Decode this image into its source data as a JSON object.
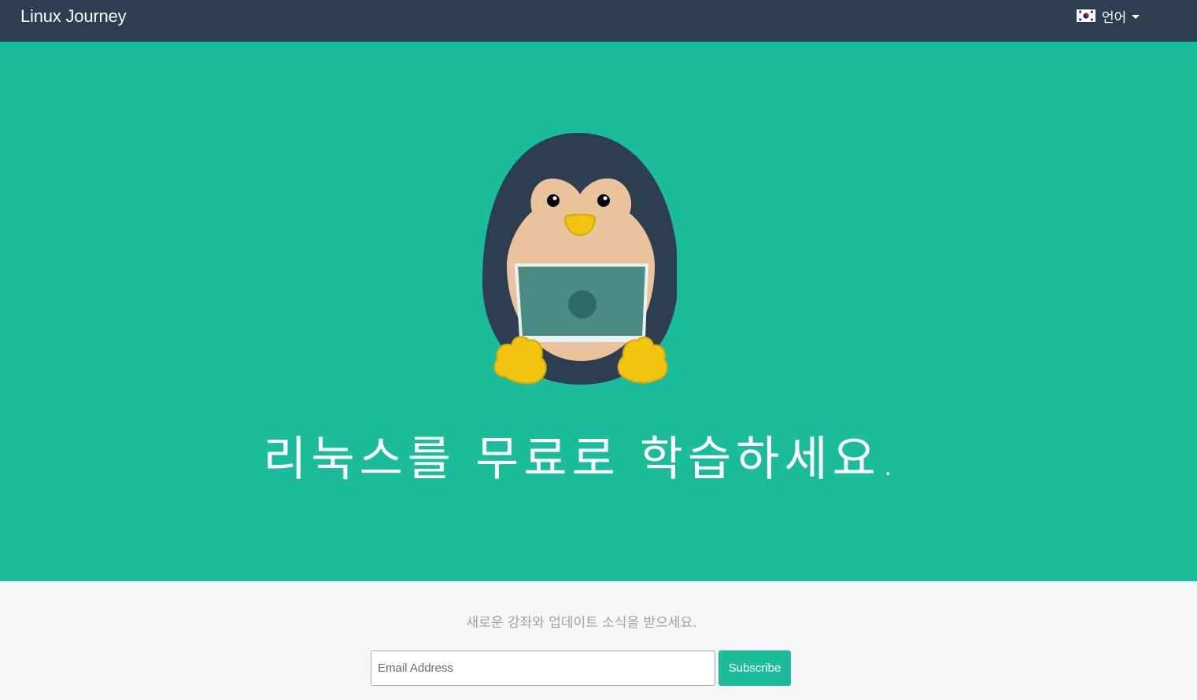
{
  "navbar": {
    "brand": "Linux Journey",
    "language_label": "언어",
    "flag_icon": "south-korea-flag-icon",
    "caret_icon": "caret-down-icon"
  },
  "hero": {
    "illustration": "penguin-with-laptop",
    "title": "리눅스를 무료로 학습하세요."
  },
  "subscribe": {
    "text": "새로운 강좌와 업데이트 소식을 받으세요.",
    "email_placeholder": "Email Address",
    "button_label": "Subscribe"
  },
  "colors": {
    "navbar_bg": "#2c3e50",
    "hero_bg": "#1abc9c",
    "accent": "#1abc9c",
    "footer_bg": "#f7f7f9"
  }
}
